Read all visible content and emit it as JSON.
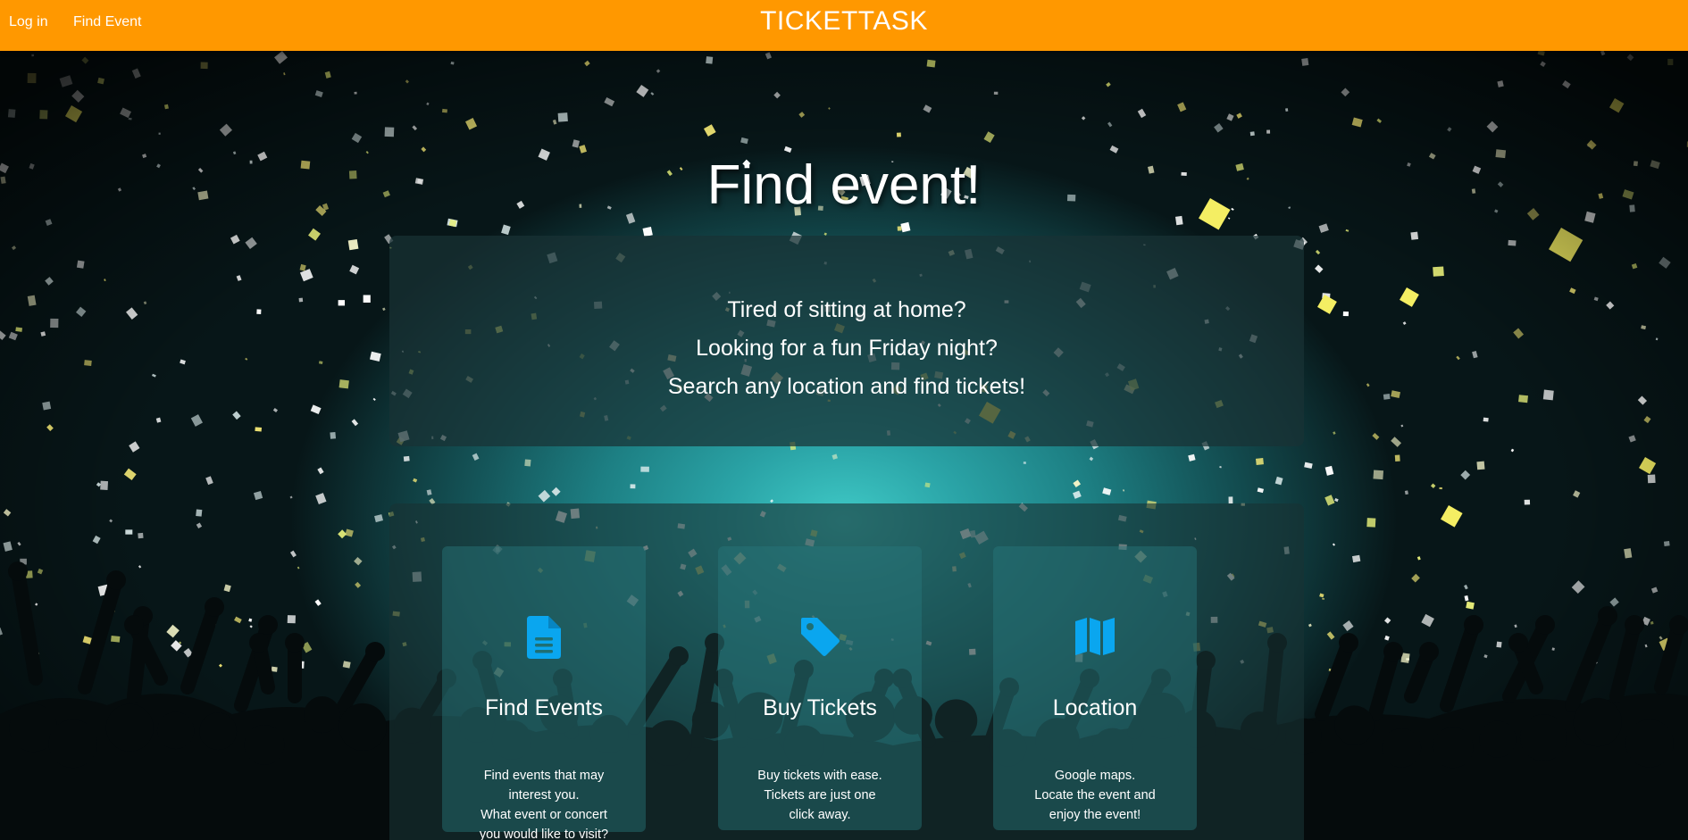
{
  "nav": {
    "login_label": "Log in",
    "find_event_label": "Find Event",
    "brand": "TICKETTASK"
  },
  "hero": {
    "title": "Find event!"
  },
  "intro": {
    "lines": [
      "Tired of sitting at home?",
      "Looking for a fun Friday night?",
      "Search any location and find tickets!"
    ]
  },
  "features": [
    {
      "icon": "document-icon",
      "title": "Find Events",
      "text": [
        "Find events that may interest you.",
        "What event or concert you would like to visit?"
      ]
    },
    {
      "icon": "tag-icon",
      "title": "Buy Tickets",
      "text": [
        "Buy tickets with ease.",
        "Tickets are just one click away."
      ]
    },
    {
      "icon": "map-icon",
      "title": "Location",
      "text": [
        "Google maps.",
        "Locate the event and enjoy the event!"
      ]
    }
  ],
  "colors": {
    "navbar": "#ff9800",
    "icon_accent": "#0aa6ef",
    "text": "#ffffff"
  }
}
